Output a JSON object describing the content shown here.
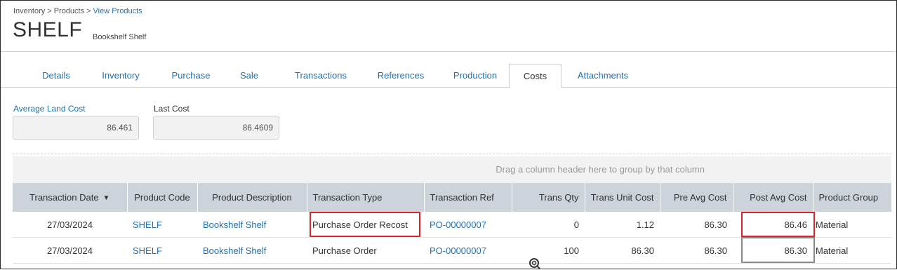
{
  "breadcrumb": {
    "root": "Inventory",
    "sep1": ">",
    "products": "Products",
    "sep2": ">",
    "current": "View Products"
  },
  "header": {
    "title": "SHELF",
    "subtitle": "Bookshelf Shelf"
  },
  "tabs": [
    {
      "label": "Details"
    },
    {
      "label": "Inventory"
    },
    {
      "label": "Purchase"
    },
    {
      "label": "Sale"
    },
    {
      "label": "Transactions"
    },
    {
      "label": "References"
    },
    {
      "label": "Production"
    },
    {
      "label": "Costs",
      "active": true
    },
    {
      "label": "Attachments"
    }
  ],
  "costs": {
    "avg_land_cost_label": "Average Land Cost",
    "avg_land_cost_value": "86.461",
    "last_cost_label": "Last Cost",
    "last_cost_value": "86.4609"
  },
  "grid": {
    "group_hint": "Drag a column header here to group by that column",
    "columns": [
      "Transaction Date",
      "Product Code",
      "Product Description",
      "Transaction Type",
      "Transaction Ref",
      "Trans Qty",
      "Trans Unit Cost",
      "Pre Avg Cost",
      "Post Avg Cost",
      "Product Group"
    ],
    "rows": [
      [
        "27/03/2024",
        "SHELF",
        "Bookshelf Shelf",
        "Purchase Order Recost",
        "PO-00000007",
        "0",
        "1.12",
        "86.30",
        "86.46",
        "Material"
      ],
      [
        "27/03/2024",
        "SHELF",
        "Bookshelf Shelf",
        "Purchase Order",
        "PO-00000007",
        "100",
        "86.30",
        "86.30",
        "86.30",
        "Material"
      ]
    ]
  },
  "colors": {
    "link": "#1f6fb2",
    "header_bg": "#ccd3db",
    "highlight_red": "#d8252c",
    "highlight_gray": "#8a8a8a"
  },
  "icons": {
    "sort": "caret-down-icon",
    "cursor": "busy-cursor-icon"
  }
}
